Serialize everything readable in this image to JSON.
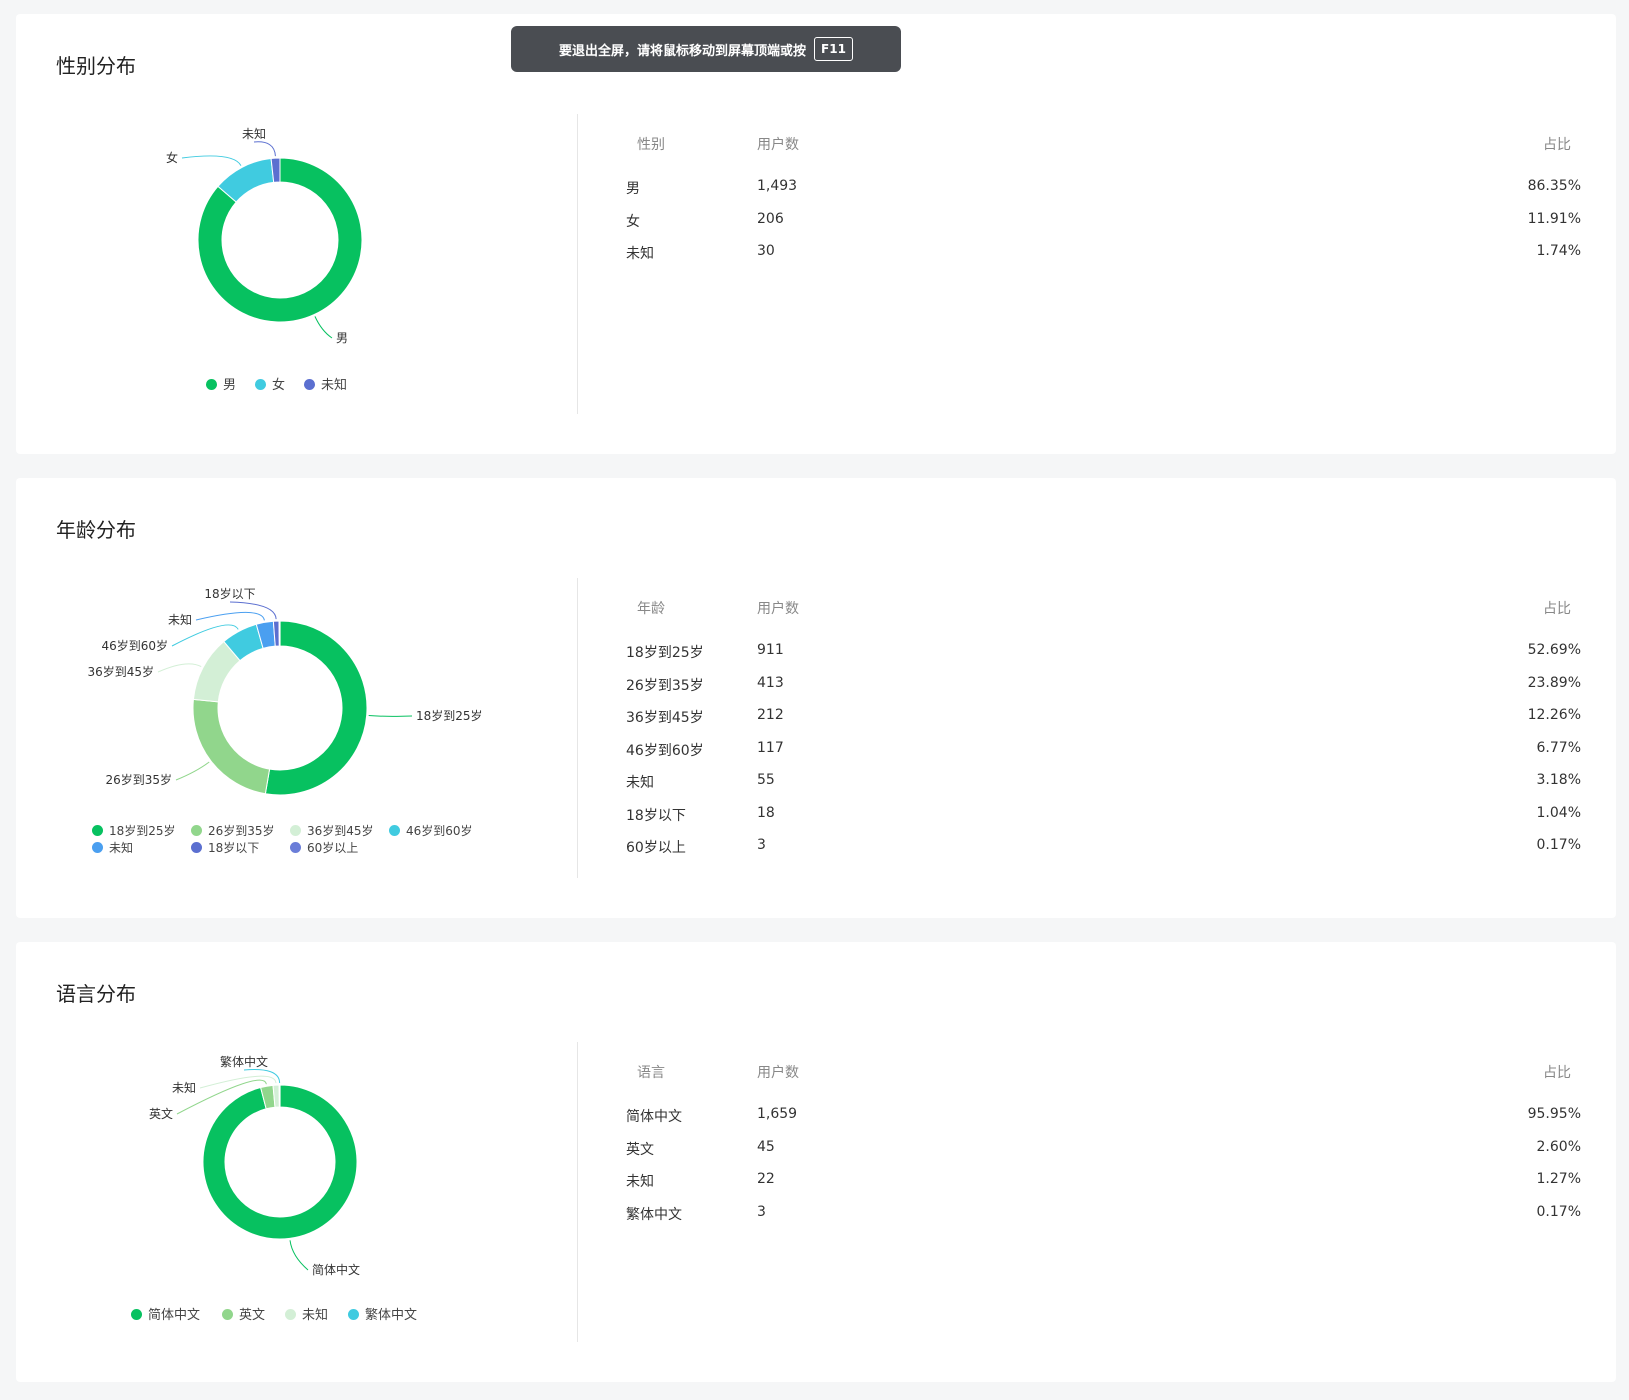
{
  "toast": {
    "message": "要退出全屏，请将鼠标移动到屏幕顶端或按",
    "key": "F11"
  },
  "sections": [
    {
      "title": "性别分布",
      "columns": [
        "性别",
        "用户数",
        "占比"
      ],
      "rows": [
        [
          "男",
          "1,493",
          "86.35%"
        ],
        [
          "女",
          "206",
          "11.91%"
        ],
        [
          "未知",
          "30",
          "1.74%"
        ]
      ]
    },
    {
      "title": "年龄分布",
      "columns": [
        "年龄",
        "用户数",
        "占比"
      ],
      "rows": [
        [
          "18岁到25岁",
          "911",
          "52.69%"
        ],
        [
          "26岁到35岁",
          "413",
          "23.89%"
        ],
        [
          "36岁到45岁",
          "212",
          "12.26%"
        ],
        [
          "46岁到60岁",
          "117",
          "6.77%"
        ],
        [
          "未知",
          "55",
          "3.18%"
        ],
        [
          "18岁以下",
          "18",
          "1.04%"
        ],
        [
          "60岁以上",
          "3",
          "0.17%"
        ]
      ]
    },
    {
      "title": "语言分布",
      "columns": [
        "语言",
        "用户数",
        "占比"
      ],
      "rows": [
        [
          "简体中文",
          "1,659",
          "95.95%"
        ],
        [
          "英文",
          "45",
          "2.60%"
        ],
        [
          "未知",
          "22",
          "1.27%"
        ],
        [
          "繁体中文",
          "3",
          "0.17%"
        ]
      ]
    }
  ],
  "chart_data": [
    {
      "type": "pie",
      "donut": true,
      "categories": [
        "男",
        "女",
        "未知"
      ],
      "values": [
        1493,
        206,
        30
      ],
      "colors": [
        "#07c160",
        "#40cbe0",
        "#5b6fd0"
      ],
      "slice_labels": [
        "男",
        "女",
        "未知"
      ],
      "legend": [
        "男",
        "女",
        "未知"
      ],
      "legend_position": "bottom"
    },
    {
      "type": "pie",
      "donut": true,
      "categories": [
        "18岁到25岁",
        "26岁到35岁",
        "36岁到45岁",
        "46岁到60岁",
        "未知",
        "18岁以下",
        "60岁以上"
      ],
      "values": [
        911,
        413,
        212,
        117,
        55,
        18,
        3
      ],
      "colors": [
        "#07c160",
        "#91d68c",
        "#d3efd6",
        "#40cbe0",
        "#4a9ff0",
        "#5b6fd0",
        "#6a7dd8"
      ],
      "slice_labels": [
        "18岁到25岁",
        "26岁到35岁",
        "36岁到45岁",
        "46岁到60岁",
        "未知",
        "18岁以下"
      ],
      "legend": [
        "18岁到25岁",
        "26岁到35岁",
        "36岁到45岁",
        "46岁到60岁",
        "未知",
        "18岁以下",
        "60岁以上"
      ],
      "legend_position": "bottom"
    },
    {
      "type": "pie",
      "donut": true,
      "categories": [
        "简体中文",
        "英文",
        "未知",
        "繁体中文"
      ],
      "values": [
        1659,
        45,
        22,
        3
      ],
      "colors": [
        "#07c160",
        "#91d68c",
        "#d3efd6",
        "#40cbe0"
      ],
      "slice_labels": [
        "简体中文",
        "英文",
        "未知",
        "繁体中文"
      ],
      "legend": [
        "简体中文",
        "英文",
        "未知",
        "繁体中文"
      ],
      "legend_position": "bottom"
    }
  ]
}
